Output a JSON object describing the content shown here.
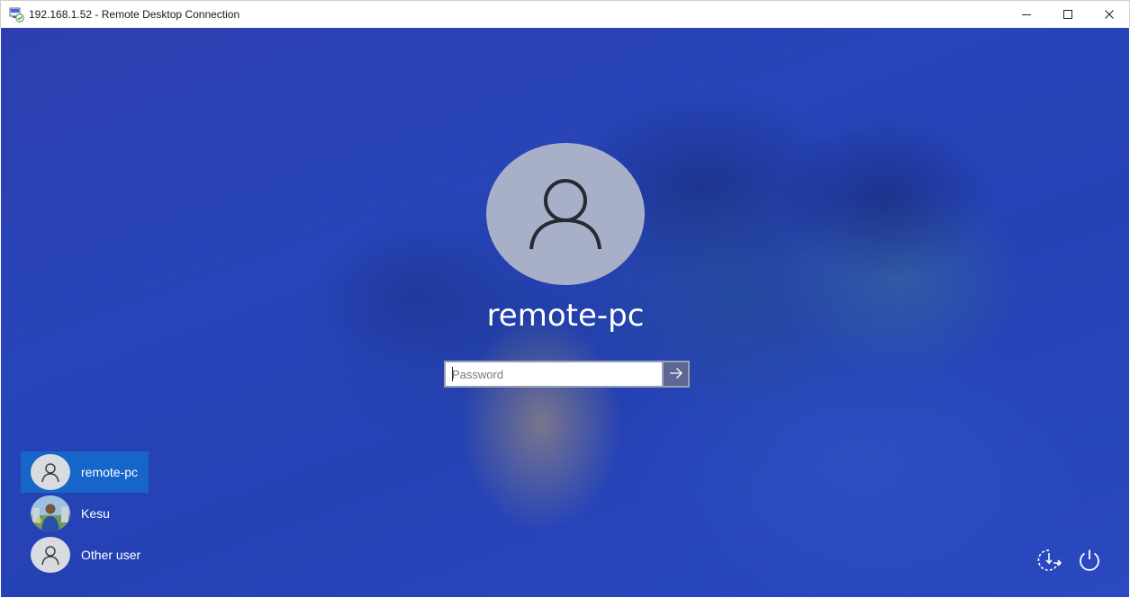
{
  "window": {
    "title": "192.168.1.52 - Remote Desktop Connection",
    "app_icon": "remote-desktop-icon",
    "controls": [
      "minimize-icon",
      "maximize-icon",
      "close-icon"
    ]
  },
  "lock_screen": {
    "avatar_icon": "user-icon",
    "user_name": "remote-pc",
    "password": {
      "value": "",
      "placeholder": "Password",
      "submit_icon": "arrow-right-icon"
    },
    "users": [
      {
        "label": "remote-pc",
        "selected": true,
        "avatar": "user-icon"
      },
      {
        "label": "Kesu",
        "selected": false,
        "avatar": "photo-avatar"
      },
      {
        "label": "Other user",
        "selected": false,
        "avatar": "user-icon"
      }
    ],
    "corner_buttons": [
      "accessibility-icon",
      "power-icon"
    ]
  },
  "colors": {
    "background": "#2744b8",
    "selected_user": "#1566c8",
    "avatar_bg": "#a7b0c8",
    "submit_bg": "#5c6794"
  }
}
